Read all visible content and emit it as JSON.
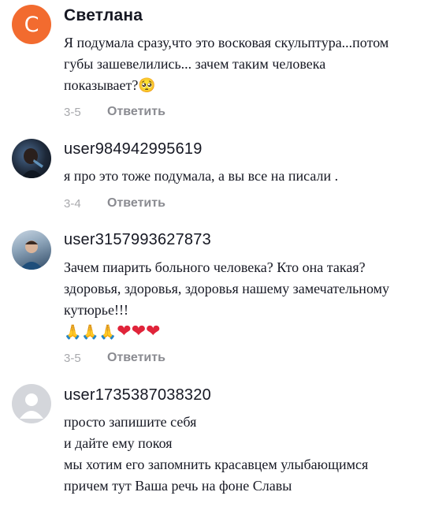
{
  "comments": [
    {
      "username": "Светлана",
      "avatar_letter": "С",
      "lines": [
        "Я подумала сразу,что это восковая скульптура...потом",
        "губы зашевелились... зачем таким человека",
        "показывает?"
      ],
      "date": "3-5",
      "reply": "Ответить"
    },
    {
      "username": "user984942995619",
      "lines": [
        "я про это тоже подумала, а вы все на писали ."
      ],
      "date": "3-4",
      "reply": "Ответить"
    },
    {
      "username": "user3157993627873",
      "lines": [
        "Зачем пиарить больного человека? Кто она такая?",
        "здоровья, здоровья, здоровья нашему замечательному",
        "кутюрье!!!"
      ],
      "emoji_line": "🙏🙏🙏❤❤❤",
      "date": "3-5",
      "reply": "Ответить"
    },
    {
      "username": "user1735387038320",
      "lines": [
        "просто запишите себя",
        "и дайте ему покоя",
        "мы хотим его запомнить красавцем улыбающимся",
        "причем тут Ваша речь на фоне Славы"
      ]
    }
  ],
  "icons": {
    "emoji_sad": "worried-face-icon",
    "heart": "heart-icon",
    "pray": "folded-hands-icon"
  },
  "colors": {
    "accent_avatar": "#f26b2f",
    "heart": "#e0243a",
    "meta": "#a8a9ad"
  }
}
